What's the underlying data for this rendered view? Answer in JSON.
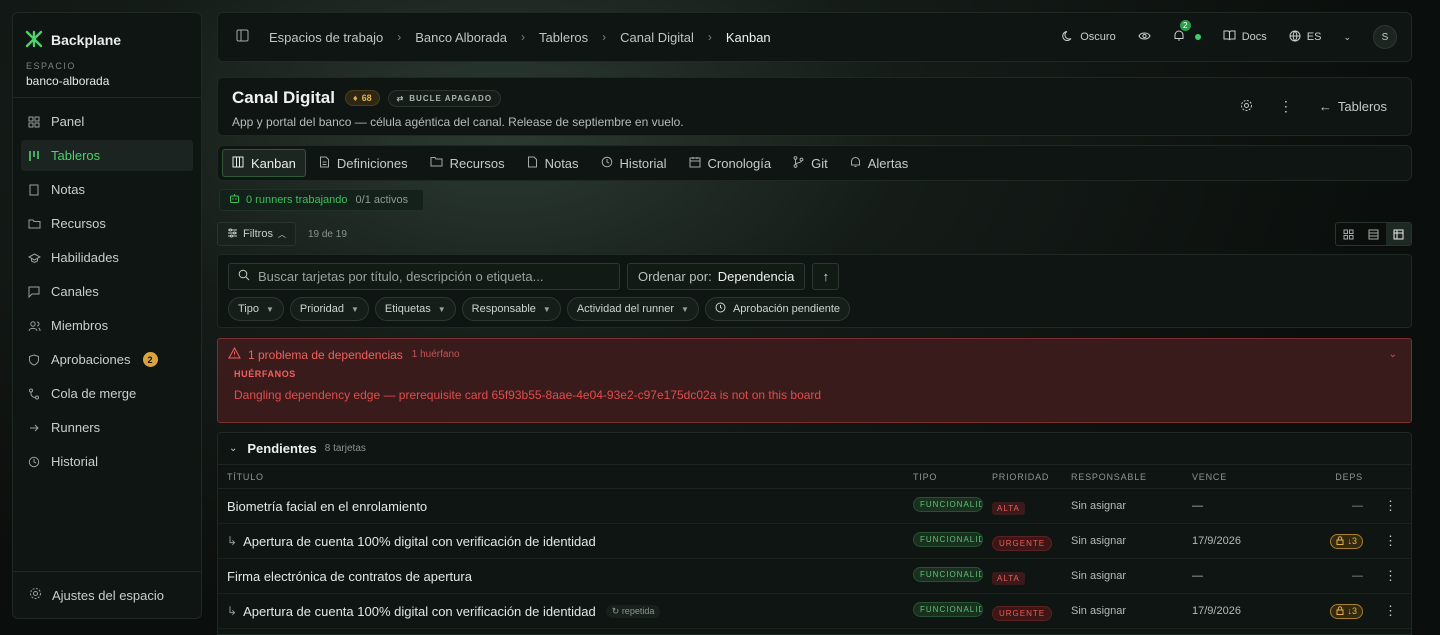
{
  "sidebar": {
    "brand": "Backplane",
    "workspace_label": "ESPACIO",
    "workspace_name": "banco-alborada",
    "items": [
      {
        "label": "Panel"
      },
      {
        "label": "Tableros"
      },
      {
        "label": "Notas"
      },
      {
        "label": "Recursos"
      },
      {
        "label": "Habilidades"
      },
      {
        "label": "Canales"
      },
      {
        "label": "Miembros"
      },
      {
        "label": "Aprobaciones",
        "badge": "2"
      },
      {
        "label": "Cola de merge"
      },
      {
        "label": "Runners"
      },
      {
        "label": "Historial"
      }
    ],
    "footer": "Ajustes del espacio"
  },
  "topbar": {
    "breadcrumbs": [
      "Espacios de trabajo",
      "Banco Alborada",
      "Tableros",
      "Canal Digital",
      "Kanban"
    ],
    "theme": "Oscuro",
    "notif_count": "2",
    "docs": "Docs",
    "lang": "ES",
    "avatar": "S"
  },
  "header": {
    "title": "Canal Digital",
    "score": "68",
    "loop": "BUCLE APAGADO",
    "description": "App y portal del banco — célula agéntica del canal. Release de septiembre en vuelo.",
    "back": "Tableros"
  },
  "tabs": [
    "Kanban",
    "Definiciones",
    "Recursos",
    "Notas",
    "Historial",
    "Cronología",
    "Git",
    "Alertas"
  ],
  "runners": {
    "working": "0 runners trabajando",
    "active": "0/1 activos"
  },
  "filters": {
    "label": "Filtros",
    "count": "19 de 19"
  },
  "search": {
    "placeholder": "Buscar tarjetas por título, descripción o etiqueta...",
    "order_label": "Ordenar por:",
    "order_value": "Dependencia"
  },
  "chips": [
    "Tipo",
    "Prioridad",
    "Etiquetas",
    "Responsable",
    "Actividad del runner",
    "Aprobación pendiente"
  ],
  "alert": {
    "title": "1 problema de dependencias",
    "subtitle": "1 huérfano",
    "heading": "HUÉRFANOS",
    "message": "Dangling dependency edge — prerequisite card 65f93b55-8aae-4e04-93e2-c97e175dc02a is not on this board"
  },
  "group": {
    "name": "Pendientes",
    "count": "8 tarjetas"
  },
  "columns": {
    "title": "TÍTULO",
    "tipo": "TIPO",
    "prioridad": "PRIORIDAD",
    "responsable": "RESPONSABLE",
    "vence": "VENCE",
    "deps": "DEPS"
  },
  "rows": [
    {
      "title": "Biometría facial en el enrolamiento",
      "tipo": "FUNCIONALIDAD",
      "prioridad": "ALTA",
      "responsable": "Sin asignar",
      "vence": "—",
      "deps": "—"
    },
    {
      "title": "Apertura de cuenta 100% digital con verificación de identidad",
      "tipo": "FUNCIONALIDAD",
      "prioridad": "URGENTE",
      "responsable": "Sin asignar",
      "vence": "17/9/2026",
      "deps": "↓3"
    },
    {
      "title": "Firma electrónica de contratos de apertura",
      "tipo": "FUNCIONALIDAD",
      "prioridad": "ALTA",
      "responsable": "Sin asignar",
      "vence": "—",
      "deps": "—"
    },
    {
      "title": "Apertura de cuenta 100% digital con verificación de identidad",
      "tag": "repetida",
      "tipo": "FUNCIONALIDAD",
      "prioridad": "URGENTE",
      "responsable": "Sin asignar",
      "vence": "17/9/2026",
      "deps": "↓3"
    }
  ]
}
